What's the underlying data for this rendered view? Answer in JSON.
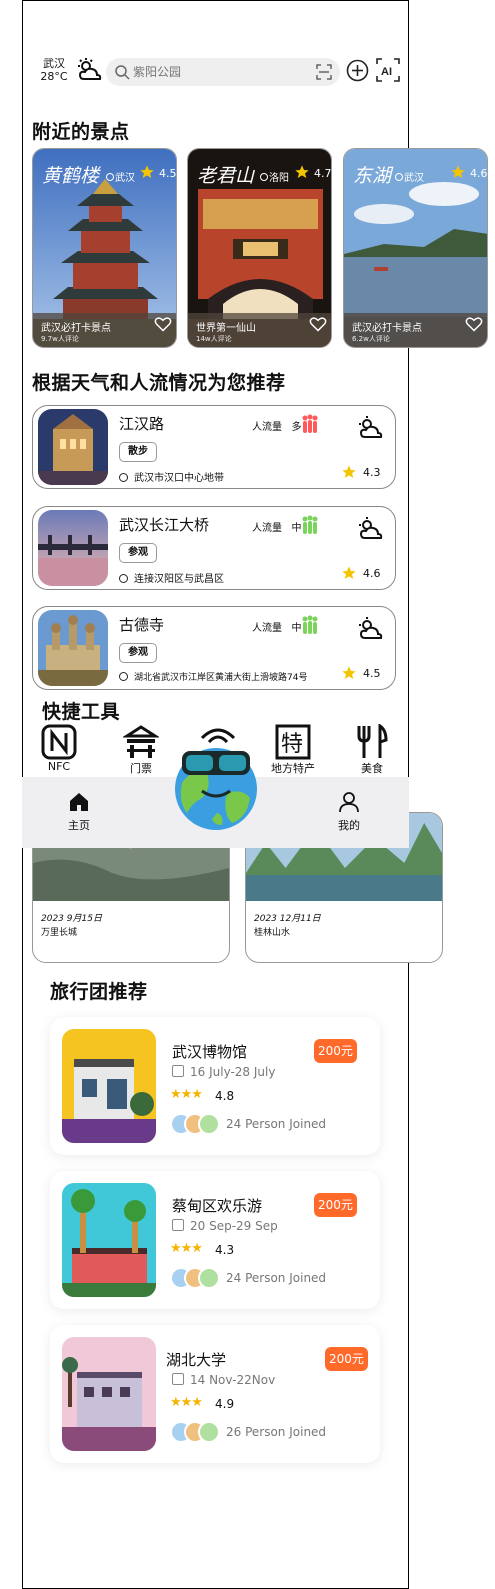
{
  "header": {
    "city": "武汉",
    "temperature": "28°C",
    "search_placeholder": "紫阳公园"
  },
  "nearby": {
    "title": "附近的景点",
    "spots": [
      {
        "name": "黄鹤楼",
        "city": "武汉",
        "rating": "4.5",
        "tag": "武汉必打卡景点",
        "comments": "9.7w人评论"
      },
      {
        "name": "老君山",
        "city": "洛阳",
        "rating": "4.7",
        "tag": "世界第一仙山",
        "comments": "14w人评论"
      },
      {
        "name": "东湖",
        "city": "武汉",
        "rating": "4.6",
        "tag": "武汉必打卡景点",
        "comments": "6.2w人评论"
      }
    ]
  },
  "recommend": {
    "title": "根据天气和人流情况为您推荐",
    "crowd_label": "人流量",
    "items": [
      {
        "name": "江汉路",
        "chip": "散步",
        "crowd": "多",
        "address": "武汉市汉口中心地带",
        "rating": "4.3"
      },
      {
        "name": "武汉长江大桥",
        "chip": "参观",
        "crowd": "中",
        "address": "连接汉阳区与武昌区",
        "rating": "4.6"
      },
      {
        "name": "古德寺",
        "chip": "参观",
        "crowd": "中",
        "address": "湖北省武汉市江岸区黄浦大街上滑坡路74号",
        "rating": "4.5"
      }
    ]
  },
  "tools": {
    "title": "快捷工具",
    "items": [
      "NFC",
      "门票",
      "地方特产",
      "美食"
    ]
  },
  "tabbar": {
    "home": "主页",
    "mine": "我的"
  },
  "memories": [
    {
      "date": "2023 9月15日",
      "place": "万里长城"
    },
    {
      "date": "2023 12月11日",
      "place": "桂林山水"
    }
  ],
  "groups": {
    "title": "旅行团推荐",
    "items": [
      {
        "name": "武汉博物馆",
        "price": "200元",
        "dates": "16 July-28 July",
        "rating": "4.8",
        "joined": "24 Person Joined"
      },
      {
        "name": "蔡甸区欢乐游",
        "price": "200元",
        "dates": "20 Sep-29 Sep",
        "rating": "4.3",
        "joined": "24 Person Joined"
      },
      {
        "name": "湖北大学",
        "price": "200元",
        "dates": "14 Nov-22Nov",
        "rating": "4.9",
        "joined": "26 Person Joined"
      }
    ]
  },
  "colors": {
    "accent": "#ff6a2a",
    "star": "#f5c400",
    "crowd_high": "#ff5a5a",
    "crowd_mid": "#7ad35a"
  }
}
